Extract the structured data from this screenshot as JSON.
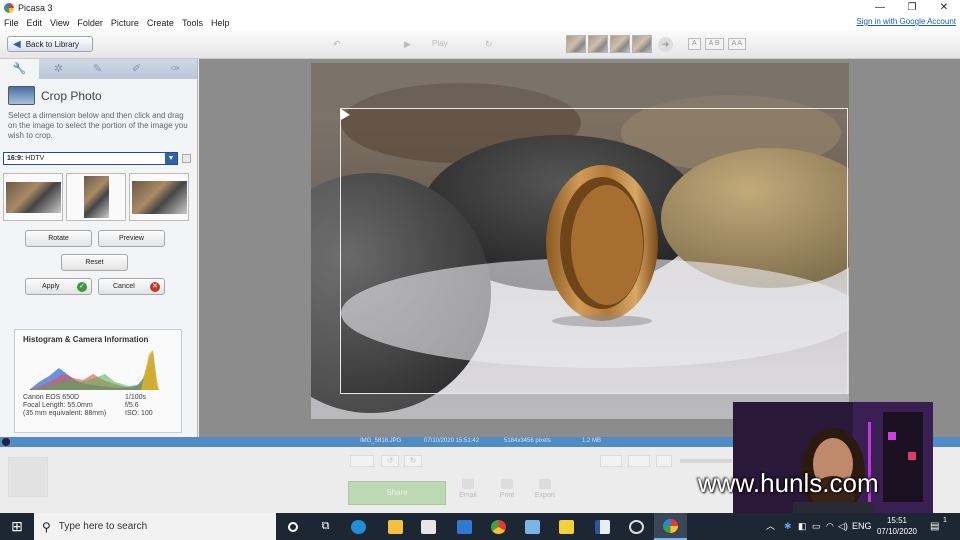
{
  "window": {
    "title": "Picasa 3",
    "controls": {
      "minimize": "—",
      "restore": "❐",
      "close": "✕"
    }
  },
  "menu": {
    "items": [
      "File",
      "Edit",
      "View",
      "Folder",
      "Picture",
      "Create",
      "Tools",
      "Help"
    ],
    "signin": "Sign in with Google Account"
  },
  "toolbar": {
    "back_label": "Back to Library",
    "play_label": "Play",
    "text_buttons": [
      "A",
      "A B",
      "A A"
    ]
  },
  "edit_panel": {
    "tabs": [
      "wrench-icon",
      "tuning-icon",
      "brush-icon",
      "effects-icon",
      "more-effects-icon"
    ],
    "title": "Crop Photo",
    "description": "Select a dimension below and then click and drag on the image to select the portion of the image you wish to crop.",
    "aspect": {
      "ratio": "16:9:",
      "name": "HDTV"
    },
    "buttons": {
      "rotate": "Rotate",
      "preview": "Preview",
      "reset": "Reset",
      "apply": "Apply",
      "cancel": "Cancel"
    }
  },
  "histogram": {
    "title": "Histogram & Camera Information",
    "camera": "Canon EOS 650D",
    "focal_length": "Focal Length: 55.0mm",
    "equivalent": "(35 mm equivalent:  88mm)",
    "shutter": "1/100s",
    "aperture": "f/5.6",
    "iso": "ISO: 100"
  },
  "status": {
    "filename": "IMG_5818.JPG",
    "datetime": "07/10/2020 15:51:42",
    "dimensions": "5184x3456 pixels",
    "size": "1.2 MB"
  },
  "tray": {
    "upload_label": "Share",
    "email_label": "Email",
    "print_label": "Print",
    "export_label": "Export"
  },
  "watermark": "www.hunls.com",
  "taskbar": {
    "search_placeholder": "Type here to search",
    "language": "ENG",
    "time": "15:51",
    "date": "07/10/2020",
    "notification_count": "1",
    "colors": {
      "taskbar": "#1d2734",
      "accent": "#4f8bc4"
    }
  }
}
